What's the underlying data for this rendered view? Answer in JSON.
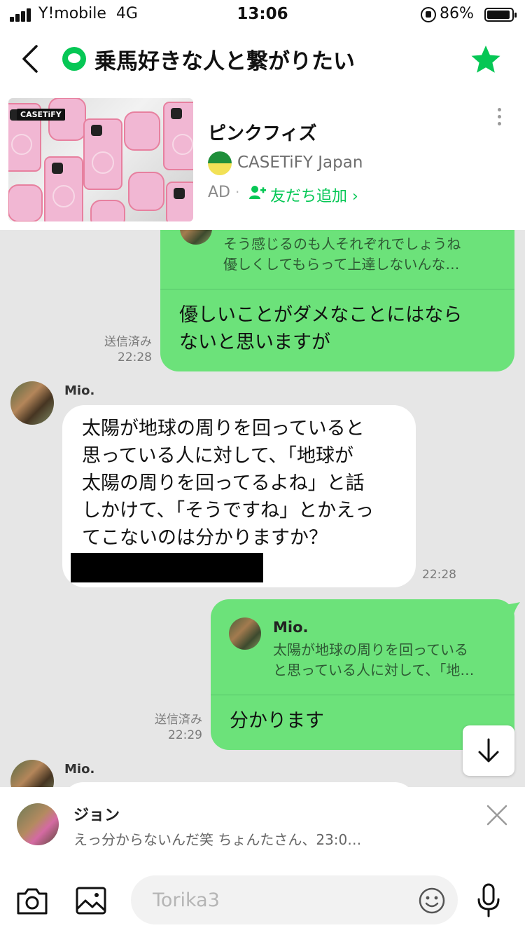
{
  "status_bar": {
    "carrier": "Y!mobile",
    "network": "4G",
    "time": "13:06",
    "battery": "86%"
  },
  "header": {
    "title": "乗馬好きな人と繋がりたい",
    "group_icon": "chat-bubble-icon",
    "star_color": "#06c755"
  },
  "ad": {
    "image_brand_tag": "CASETiFY",
    "title": "ピンクフィズ",
    "brand_name": "CASETiFY Japan",
    "ad_label": "AD",
    "separator": "·",
    "add_friend": "友だち追加",
    "add_friend_chevron": "›",
    "accent_color": "#06c755"
  },
  "chat": {
    "bg_color": "#e6e6e6",
    "messages": [
      {
        "side": "right",
        "reply_text_line1": "そう感じるのも人それぞれでしょうね",
        "reply_text_line2": "優しくしてもらって上達しないんな…",
        "text_line1": "優しいことがダメなことにはなら",
        "text_line2": "ないと思いますが",
        "status": "送信済み",
        "time": "22:28"
      },
      {
        "side": "left",
        "sender": "Mio.",
        "text_line1": "太陽が地球の周りを回っていると",
        "text_line2": "思っている人に対して、「地球が",
        "text_line3": "太陽の周りを回ってるよね」と話",
        "text_line4": "しかけて、「そうですね」とかえっ",
        "text_line5": "てこないのは分かりますか？",
        "time": "22:28"
      },
      {
        "side": "right",
        "reply_name": "Mio.",
        "reply_text_line1": "太陽が地球の周りを回っている",
        "reply_text_line2": "と思っている人に対して、「地…",
        "text_line1": "分かります",
        "status": "送信済み",
        "time": "22:29"
      },
      {
        "side": "left",
        "sender": "Mio."
      }
    ],
    "bubble_green": "#6ce27a"
  },
  "notification": {
    "name": "ジョン",
    "text": "えっ分からないんだ笑 ちょんたさん、23:0…"
  },
  "input_bar": {
    "placeholder": "Torika3"
  }
}
